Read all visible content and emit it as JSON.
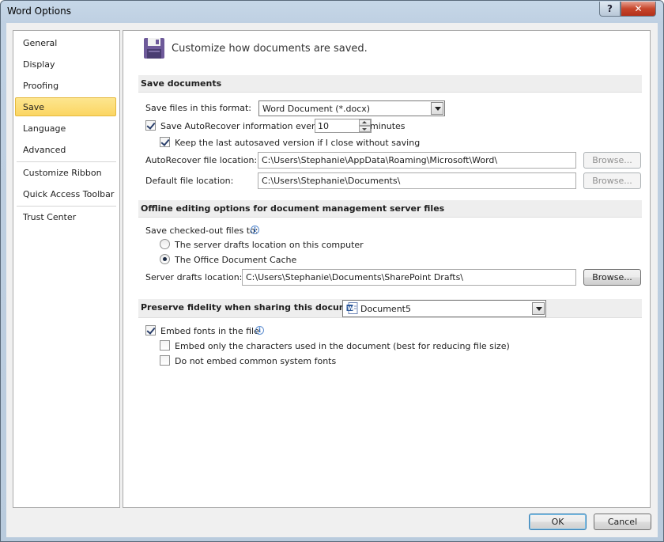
{
  "window": {
    "title": "Word Options",
    "help_glyph": "?",
    "close_glyph": "✕"
  },
  "sidebar": {
    "items": [
      {
        "label": "General"
      },
      {
        "label": "Display"
      },
      {
        "label": "Proofing"
      },
      {
        "label": "Save",
        "selected": true
      },
      {
        "label": "Language"
      },
      {
        "label": "Advanced"
      },
      {
        "label": "Customize Ribbon"
      },
      {
        "label": "Quick Access Toolbar"
      },
      {
        "label": "Trust Center"
      }
    ]
  },
  "header": {
    "text": "Customize how documents are saved.",
    "icon": "floppy-disk-icon"
  },
  "save_documents": {
    "section_title": "Save documents",
    "format_label": "Save files in this format:",
    "format_value": "Word Document (*.docx)",
    "autorecover_label": "Save AutoRecover information every",
    "autorecover_checked": true,
    "autorecover_minutes": "10",
    "minutes_label": "minutes",
    "keep_last_label": "Keep the last autosaved version if I close without saving",
    "keep_last_checked": true,
    "autorecover_location_label": "AutoRecover file location:",
    "autorecover_location_value": "C:\\Users\\Stephanie\\AppData\\Roaming\\Microsoft\\Word\\",
    "default_location_label": "Default file location:",
    "default_location_value": "C:\\Users\\Stephanie\\Documents\\",
    "browse_label": "Browse..."
  },
  "offline": {
    "section_title": "Offline editing options for document management server files",
    "checkout_label": "Save checked-out files to:",
    "radio_server_label": "The server drafts location on this computer",
    "radio_cache_label": "The Office Document Cache",
    "selected_radio": "cache",
    "server_drafts_label": "Server drafts location:",
    "server_drafts_value": "C:\\Users\\Stephanie\\Documents\\SharePoint Drafts\\",
    "browse_label": "Browse..."
  },
  "fidelity": {
    "section_title": "Preserve fidelity when sharing this document:",
    "document_value": "Document5",
    "embed_fonts_label": "Embed fonts in the file",
    "embed_fonts_checked": true,
    "embed_chars_label": "Embed only the characters used in the document (best for reducing file size)",
    "embed_chars_checked": false,
    "no_common_label": "Do not embed common system fonts",
    "no_common_checked": false
  },
  "footer": {
    "ok_label": "OK",
    "cancel_label": "Cancel"
  },
  "colors": {
    "selected_nav": "#fbd562",
    "close_red": "#c7462c",
    "link_blue": "#2d6bc2"
  }
}
